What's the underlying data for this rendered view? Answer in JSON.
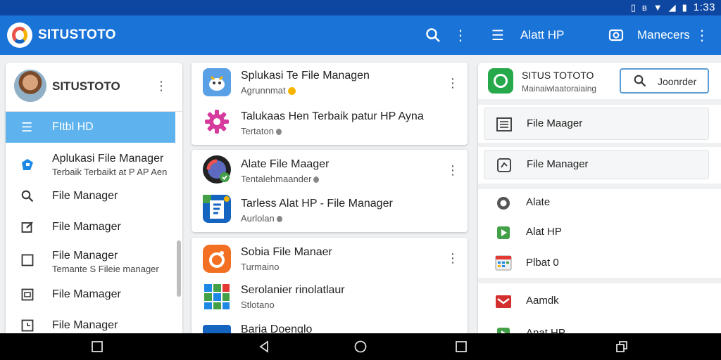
{
  "status_bar": {
    "time": "1:33"
  },
  "app_bar": {
    "title": "SITUSTOTO",
    "section_label": "Alatt HP",
    "account_label": "Manecers"
  },
  "left_panel": {
    "profile_name": "SITUSTOTO",
    "selected_item": "FItbl HD",
    "items": [
      {
        "title": "Aplukasi File Manager",
        "subtitle": "Terbaik Terbaikt at P AP Aen"
      },
      {
        "title": "File Manager",
        "subtitle": ""
      },
      {
        "title": "File Mamager",
        "subtitle": ""
      },
      {
        "title": "File Manager",
        "subtitle": "Temante S Fileie manager"
      },
      {
        "title": "File Mamager",
        "subtitle": ""
      },
      {
        "title": "File Manager",
        "subtitle": ""
      }
    ]
  },
  "center_cards": [
    {
      "rows": [
        {
          "title": "Splukasi Te File Managen",
          "subtitle": "Agrunnmat",
          "icon": "bird-app-icon"
        },
        {
          "title": "Talukaas Hen Terbaik patur HP Ayna",
          "subtitle": "Tertaton",
          "icon": "gear-pink-icon"
        }
      ]
    },
    {
      "rows": [
        {
          "title": "Alate File Maager",
          "subtitle": "Tentalehmaander",
          "icon": "camera-app-icon"
        },
        {
          "title": "Tarless Alat HP - File Manager",
          "subtitle": "Aurlolan",
          "icon": "files-app-icon"
        }
      ]
    },
    {
      "rows": [
        {
          "title": "Sobia File Manaer",
          "subtitle": "Turmaino",
          "icon": "orange-app-icon"
        },
        {
          "title": "Serolanier rinolatlaur",
          "subtitle": "Stlotano",
          "icon": "grid-app-icon"
        },
        {
          "title": "Baria Doenglo",
          "subtitle": "",
          "icon": "doc-app-icon"
        }
      ]
    }
  ],
  "right_panel": {
    "header_title": "SITUS TOTOTO",
    "header_subtitle": "Mainaiwlaatoraiaing",
    "search_label": "Joonrder",
    "boxes": [
      {
        "label": "File Maager",
        "icon": "list-icon"
      },
      {
        "label": "File Manager",
        "icon": "sync-icon"
      }
    ],
    "rows": [
      {
        "label": "Alate",
        "icon": "circle-icon"
      },
      {
        "label": "Alat HP",
        "icon": "play-icon"
      },
      {
        "label": "Plbat 0",
        "icon": "calendar-icon"
      },
      {
        "label": "Aamdk",
        "icon": "mail-icon"
      },
      {
        "label": "Anat HP",
        "icon": "play-icon"
      }
    ]
  },
  "colors": {
    "status_bar": "#0d47a1",
    "app_bar": "#1a74d8",
    "selected_item": "#5eb3ee",
    "accent_green": "#26a94b"
  }
}
